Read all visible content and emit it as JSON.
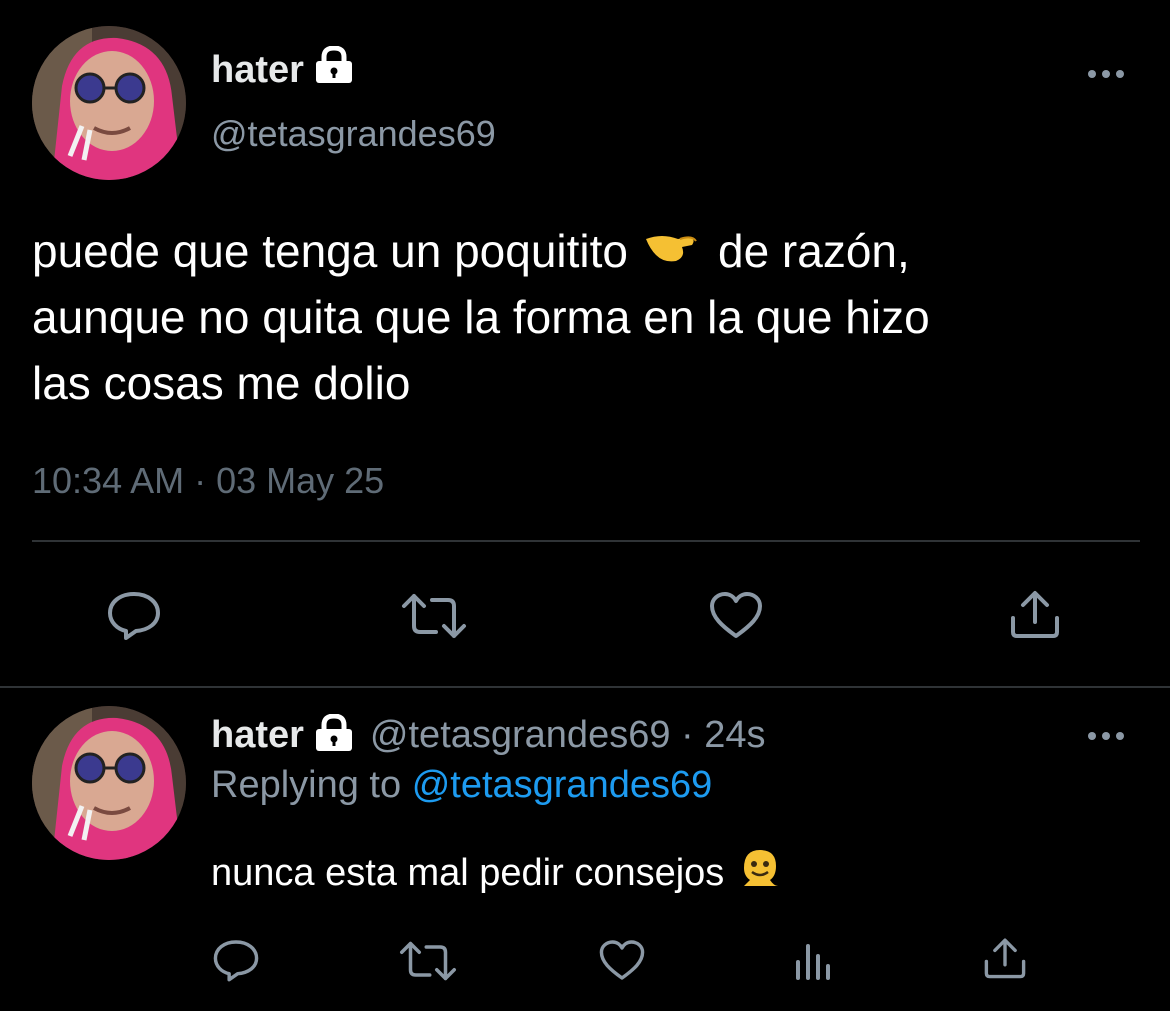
{
  "main_tweet": {
    "display_name": "hater",
    "handle": "@tetasgrandes69",
    "text_before_emoji": "puede que tenga un poquitito",
    "emoji": "pinching-hand-emoji",
    "text_after_emoji": "de razón,",
    "text_line2": "aunque no quita que la forma en la que hizo",
    "text_line3": "las cosas me dolio",
    "timestamp": "10:34 AM · 03 May 25"
  },
  "reply_tweet": {
    "display_name": "hater",
    "handle_time": "@tetasgrandes69 · 24s",
    "replying_prefix": "Replying to",
    "replying_handle": "@tetasgrandes69",
    "text": "nunca esta mal pedir consejos",
    "emoji": "melting-face-emoji"
  },
  "icons": {
    "more": "more-icon",
    "reply": "reply-icon",
    "retweet": "retweet-icon",
    "like": "like-icon",
    "views": "views-icon",
    "share": "share-icon",
    "lock": "lock-icon"
  },
  "colors": {
    "background": "#000000",
    "text": "#e7e9ea",
    "secondary": "#8b98a5",
    "link": "#1d9bf0",
    "divider": "#2f3336"
  }
}
